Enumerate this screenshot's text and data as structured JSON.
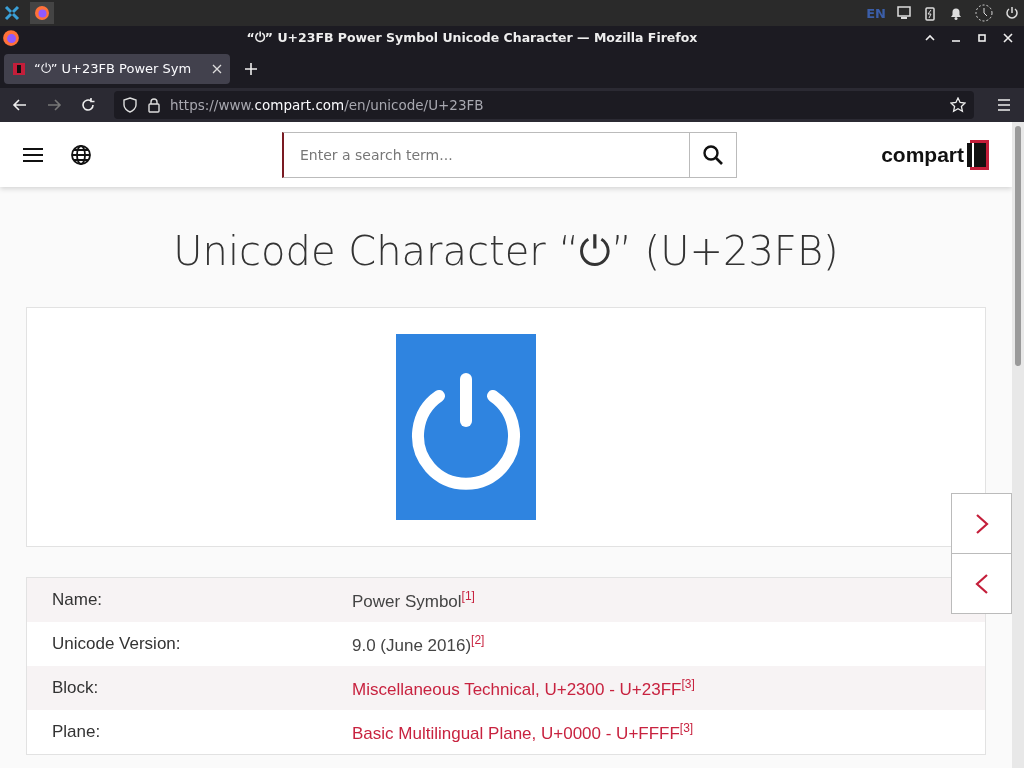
{
  "system_bar": {
    "language": "EN"
  },
  "window": {
    "title": "“⏻” U+23FB Power Symbol Unicode Character — Mozilla Firefox"
  },
  "tabs": [
    {
      "label": "“⏻” U+23FB Power Sym",
      "selected": true
    }
  ],
  "address_bar": {
    "prefix": "https://www.",
    "domain": "compart.com",
    "path": "/en/unicode/U+23FB"
  },
  "site_header": {
    "search": {
      "placeholder": "Enter a search term..."
    },
    "logo": "compart"
  },
  "page_title": "Unicode Character “⏻” (U+23FB)",
  "properties": [
    {
      "label": "Name:",
      "value": "Power Symbol$^{[1]}$",
      "kind": "text"
    },
    {
      "label": "Unicode Version:",
      "value": "9.0 (June 2016)$^{[2]}$",
      "kind": "text"
    },
    {
      "label": "Block:",
      "value": "Miscellaneous Technical, U+2300 - U+23FF$^{[3]}$",
      "kind": "link"
    },
    {
      "label": "Plane:",
      "value": "Basic Multilingual Plane, U+0000 - U+FFFF$^{[3]}$",
      "kind": "link"
    }
  ]
}
